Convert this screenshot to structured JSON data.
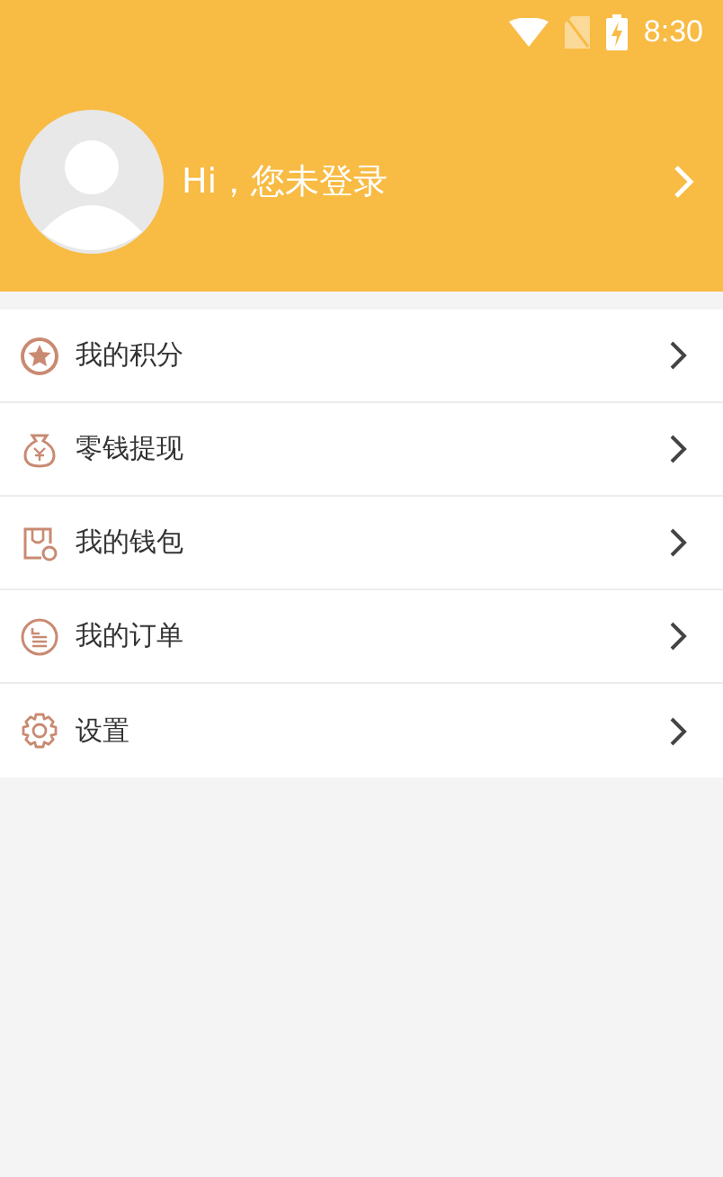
{
  "status_bar": {
    "time": "8:30"
  },
  "profile": {
    "greeting": "Hi，您未登录"
  },
  "menu": [
    {
      "label": "我的积分",
      "kind": "points"
    },
    {
      "label": "零钱提现",
      "kind": "cash"
    },
    {
      "label": "我的钱包",
      "kind": "wallet"
    },
    {
      "label": "我的订单",
      "kind": "orders"
    },
    {
      "label": "设置",
      "kind": "settings"
    }
  ]
}
